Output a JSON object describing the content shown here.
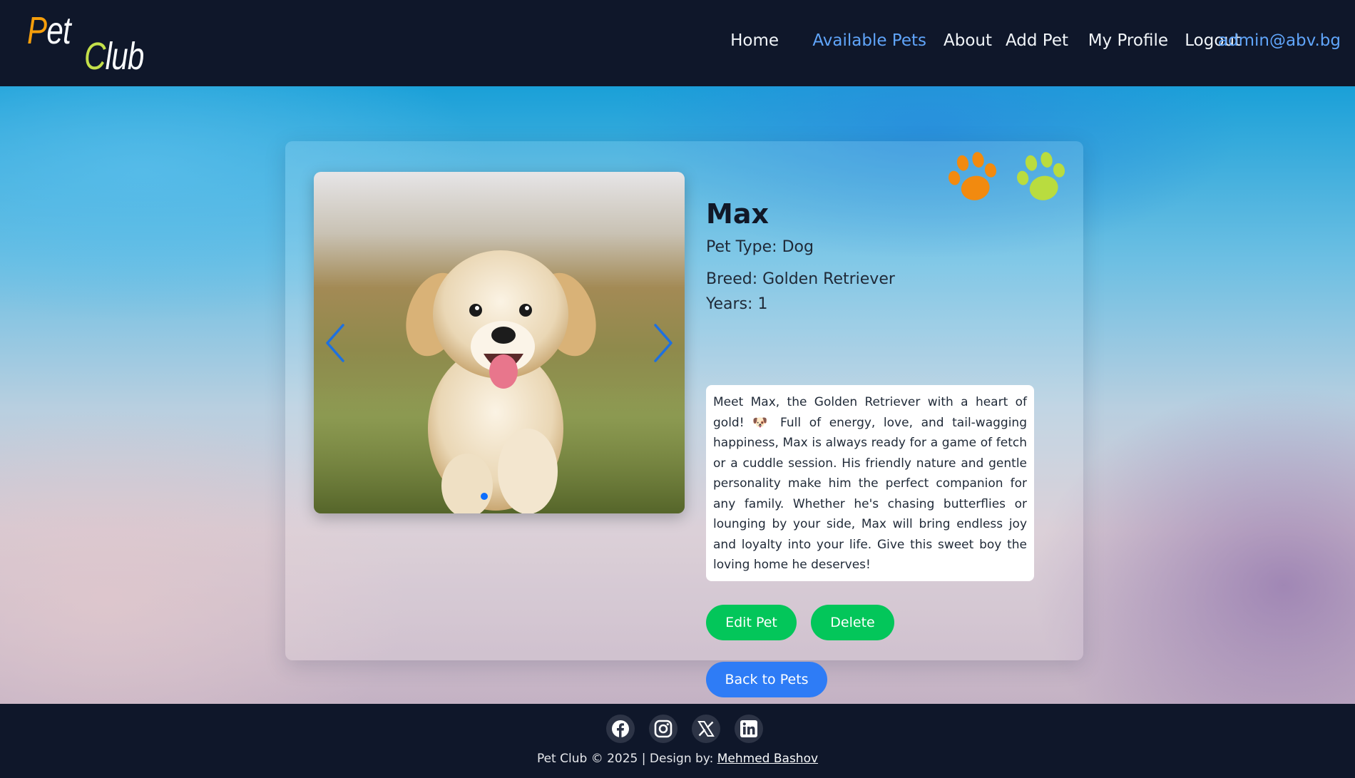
{
  "header": {
    "logo": {
      "word1": "Pet",
      "word2": "Club",
      "accent_pet": "#f59e0b",
      "accent_club": "#c4e04a"
    },
    "nav": [
      {
        "label": "Home",
        "active": false
      },
      {
        "label": "Available Pets",
        "active": true
      },
      {
        "label": "About",
        "active": false
      },
      {
        "label": "Add Pet",
        "active": false
      },
      {
        "label": "My Profile",
        "active": false
      },
      {
        "label": "Logout",
        "active": false
      }
    ],
    "user_email": "admin@abv.bg",
    "accent_color": "#60a5fa"
  },
  "pet": {
    "name": "Max",
    "type_line": "Pet Type: Dog",
    "breed_line": "Breed: Golden Retriever",
    "years_line": "Years: 1",
    "description": "Meet Max, the Golden Retriever with a heart of gold! 🐶  Full of energy, love, and tail-wagging happiness, Max is always ready for a game of fetch or a cuddle session. His friendly nature and gentle personality make him the perfect companion for any family. Whether he's chasing butterflies or lounging by your side, Max will bring endless joy and loyalty into your life. Give this sweet boy the loving home he deserves!",
    "image_alt": "puppy-photo"
  },
  "carousel": {
    "prev_icon": "chevron-left-icon",
    "next_icon": "chevron-right-icon",
    "active_slide": 1,
    "slide_count": 1
  },
  "actions": {
    "edit_label": "Edit Pet",
    "delete_label": "Delete",
    "back_label": "Back to Pets",
    "green_color": "#03c65a",
    "blue_color": "#2e7cf6"
  },
  "footer": {
    "social_icons": [
      "facebook-icon",
      "instagram-icon",
      "x-icon",
      "linkedin-icon"
    ],
    "copyright": "Pet Club © 2025 | Design by: ",
    "designer": "Mehmed Bashov"
  }
}
